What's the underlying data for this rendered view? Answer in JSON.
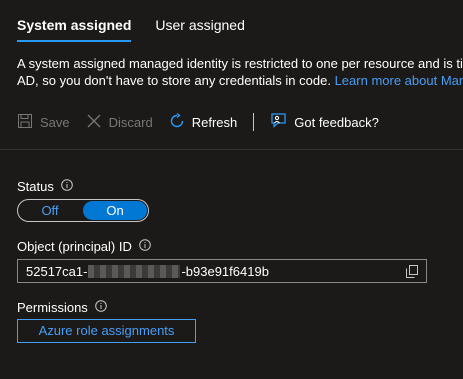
{
  "tabs": [
    {
      "label": "System assigned"
    },
    {
      "label": "User assigned"
    }
  ],
  "description": {
    "line1": "A system assigned managed identity is restricted to one per resource and is tie",
    "line2_prefix": "AD, so you don't have to store any credentials in code.",
    "link": "Learn more about Man"
  },
  "toolbar": {
    "save": "Save",
    "discard": "Discard",
    "refresh": "Refresh",
    "feedback": "Got feedback?"
  },
  "status": {
    "label": "Status",
    "off": "Off",
    "on": "On",
    "value": "On"
  },
  "object_id": {
    "label": "Object (principal) ID",
    "prefix": "52517ca1-",
    "suffix": "-b93e91f6419b"
  },
  "permissions": {
    "label": "Permissions",
    "button": "Azure role assignments"
  },
  "colors": {
    "background": "#1b1a19",
    "accent": "#0078d4",
    "link": "#479ef5"
  }
}
